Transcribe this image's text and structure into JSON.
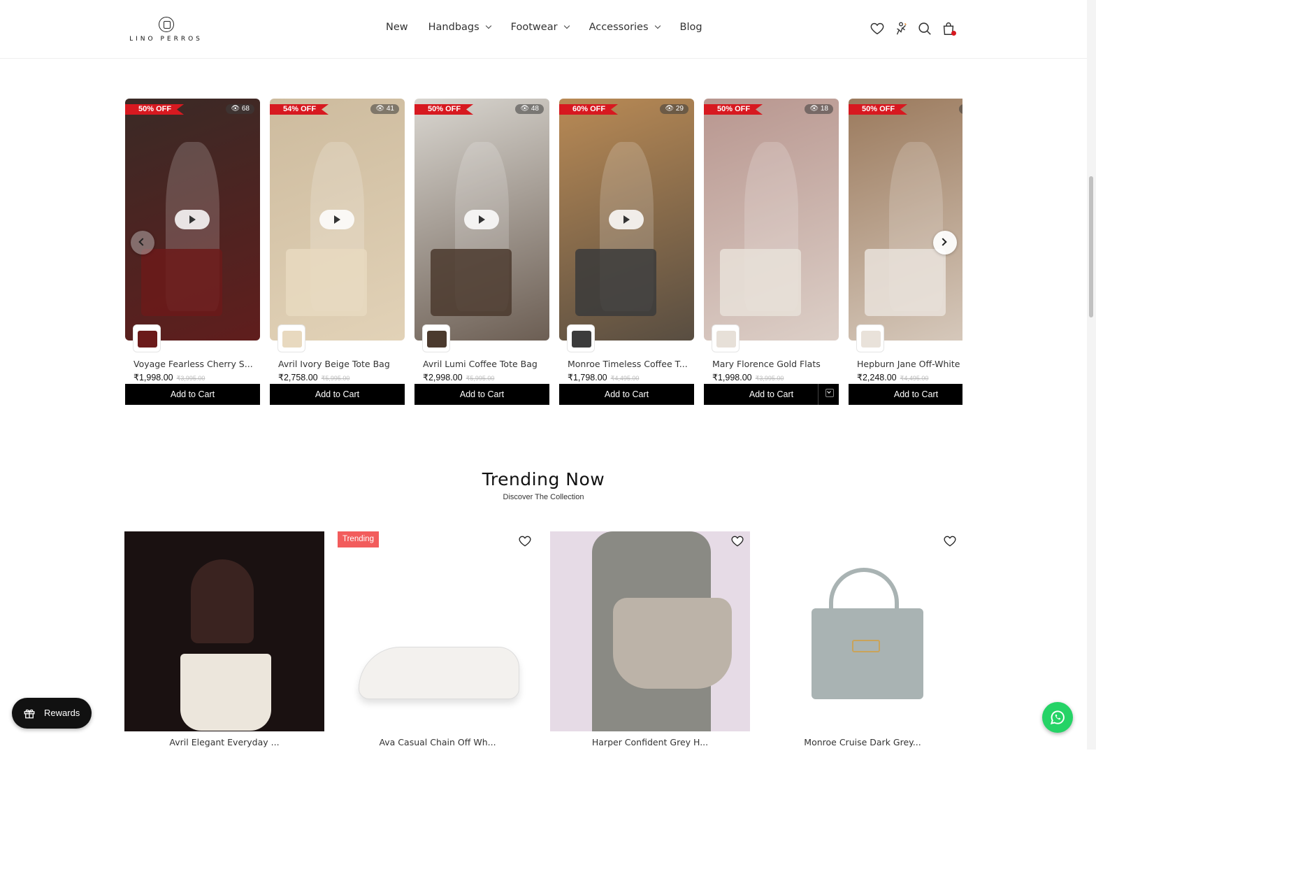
{
  "brand": {
    "name": "LINO PERROS"
  },
  "nav": {
    "items": [
      {
        "label": "New",
        "dropdown": false
      },
      {
        "label": "Handbags",
        "dropdown": true
      },
      {
        "label": "Footwear",
        "dropdown": true
      },
      {
        "label": "Accessories",
        "dropdown": true
      },
      {
        "label": "Blog",
        "dropdown": false
      }
    ]
  },
  "header_icons": [
    "heart-icon",
    "rewards-icon",
    "search-icon",
    "cart-icon"
  ],
  "video_carousel": {
    "items": [
      {
        "discount": "50% OFF",
        "views": "68",
        "name": "Voyage Fearless Cherry S...",
        "price": "₹1,998.00",
        "old_price": "₹3,995.00",
        "button": "Add to Cart",
        "has_play": true,
        "bg": "#3a2a26",
        "accent": "#6b1a1a"
      },
      {
        "discount": "54% OFF",
        "views": "41",
        "name": "Avril Ivory Beige Tote Bag",
        "price": "₹2,758.00",
        "old_price": "₹5,995.00",
        "button": "Add to Cart",
        "has_play": true,
        "bg": "#cdbb9e",
        "accent": "#e8d9bf"
      },
      {
        "discount": "50% OFF",
        "views": "48",
        "name": "Avril Lumi Coffee Tote Bag",
        "price": "₹2,998.00",
        "old_price": "₹5,995.00",
        "button": "Add to Cart",
        "has_play": true,
        "bg": "#d9d6d0",
        "accent": "#4b3a2e"
      },
      {
        "discount": "60% OFF",
        "views": "29",
        "name": "Monroe Timeless Coffee T...",
        "price": "₹1,798.00",
        "old_price": "₹4,495.00",
        "button": "Add to Cart",
        "has_play": true,
        "bg": "#b98a55",
        "accent": "#3b3b3b"
      },
      {
        "discount": "50% OFF",
        "views": "18",
        "name": "Mary Florence Gold Flats",
        "price": "₹1,998.00",
        "old_price": "₹3,995.00",
        "button": "Add to Cart",
        "has_play": false,
        "bg": "#b8968f",
        "accent": "#e7e0d8"
      },
      {
        "discount": "50% OFF",
        "views": "",
        "name": "Hepburn Jane Off-White",
        "price": "₹2,248.00",
        "old_price": "₹4,495.00",
        "button": "Add to Cart",
        "has_play": false,
        "bg": "#9b7a5d",
        "accent": "#e9e2da"
      }
    ]
  },
  "trending": {
    "title": "Trending Now",
    "subtitle": "Discover The Collection",
    "products": [
      {
        "name": "Avril Elegant Everyday ...",
        "badge": "",
        "bg": "#1a1111",
        "item": "#ece6dc"
      },
      {
        "name": "Ava Casual Chain Off Wh...",
        "badge": "Trending",
        "bg": "#ffffff",
        "item": "#f3f1ee"
      },
      {
        "name": "Harper Confident Grey H...",
        "badge": "",
        "bg": "#e6dbe6",
        "item": "#bcb3a8"
      },
      {
        "name": "Monroe Cruise Dark Grey...",
        "badge": "",
        "bg": "#ffffff",
        "item": "#a9b3b3"
      }
    ]
  },
  "floating": {
    "rewards_label": "Rewards"
  },
  "colors": {
    "discount_red": "#d71920",
    "trending_badge": "#f25c5c",
    "whatsapp": "#25d366"
  }
}
